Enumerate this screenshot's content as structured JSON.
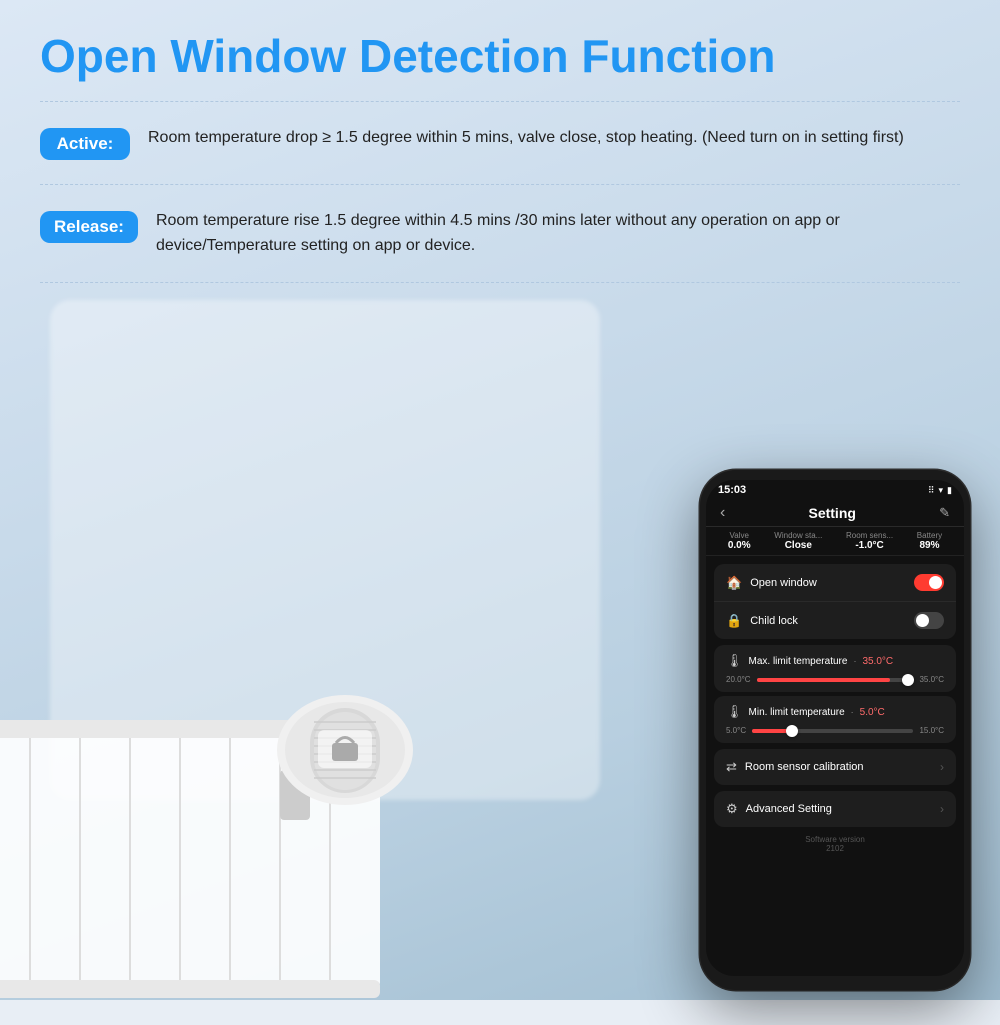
{
  "title": "Open Window Detection Function",
  "active_label": "Active:",
  "active_text": "Room temperature drop ≥ 1.5 degree within 5 mins, valve close, stop heating. (Need turn on in setting first)",
  "release_label": "Release:",
  "release_text": "Room temperature rise 1.5 degree within 4.5 mins /30 mins later without any operation on app or device/Temperature setting on app or device.",
  "phone": {
    "time": "15:03",
    "icons": "⠿ ▾ ●",
    "back_label": "‹",
    "header_title": "Setting",
    "edit_label": "✎",
    "status_items": [
      {
        "label": "Valve",
        "value": "0.0%"
      },
      {
        "label": "Window sta...",
        "value": "Close"
      },
      {
        "label": "Room sens...",
        "value": "-1.0°C"
      },
      {
        "label": "Battery",
        "value": "89%"
      }
    ],
    "open_window_label": "Open window",
    "open_window_state": "on",
    "child_lock_label": "Child lock",
    "child_lock_state": "off",
    "max_temp_label": "Max. limit temperature",
    "max_temp_value": "35.0°C",
    "max_temp_min": "20.0°C",
    "max_temp_max": "35.0°C",
    "min_temp_label": "Min. limit temperature",
    "min_temp_value": "5.0°C",
    "min_temp_min": "5.0°C",
    "min_temp_max": "15.0°C",
    "room_sensor_label": "Room sensor calibration",
    "advanced_label": "Advanced Setting",
    "software_version_label": "Software version",
    "software_version_value": "2102"
  }
}
